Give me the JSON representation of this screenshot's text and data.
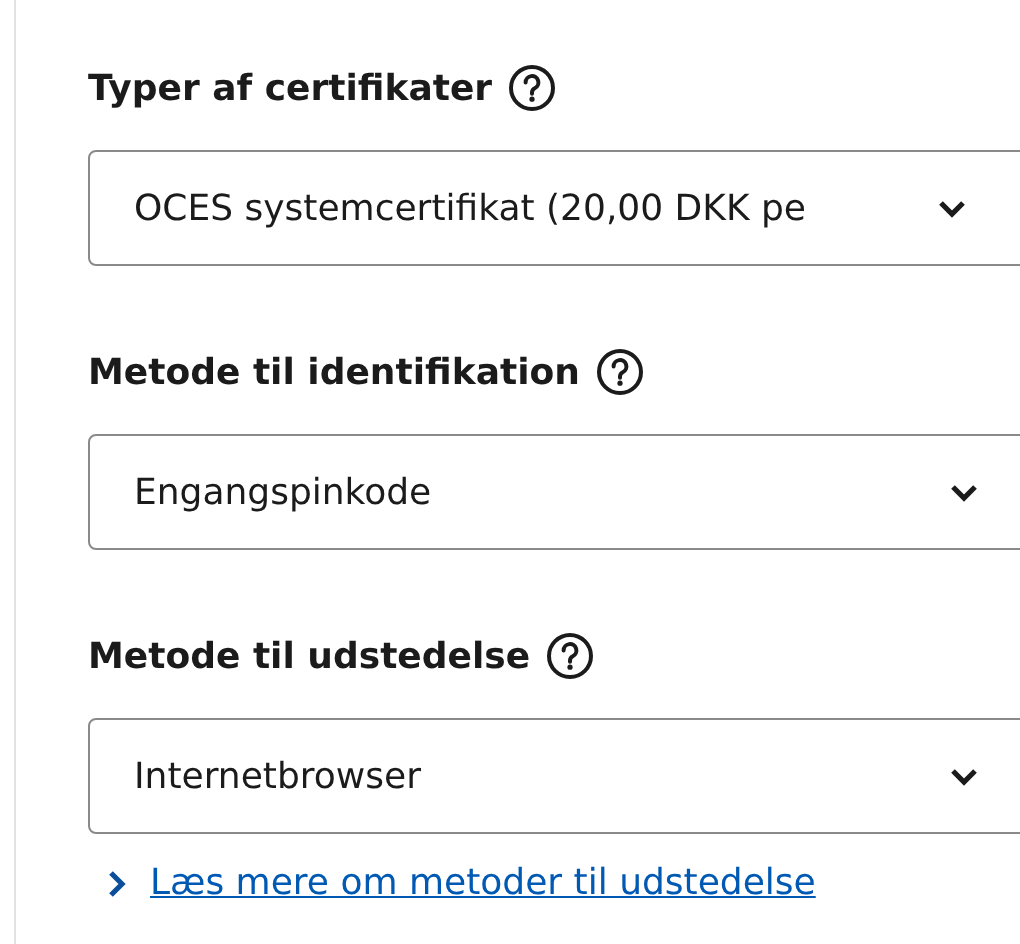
{
  "fields": [
    {
      "label": "Typer af certifikater",
      "value": "OCES systemcertifikat (20,00 DKK pe"
    },
    {
      "label": "Metode til identifikation",
      "value": "Engangspinkode"
    },
    {
      "label": "Metode til udstedelse",
      "value": "Internetbrowser"
    }
  ],
  "link": {
    "text": "Læs mere om metoder til udstedelse"
  }
}
